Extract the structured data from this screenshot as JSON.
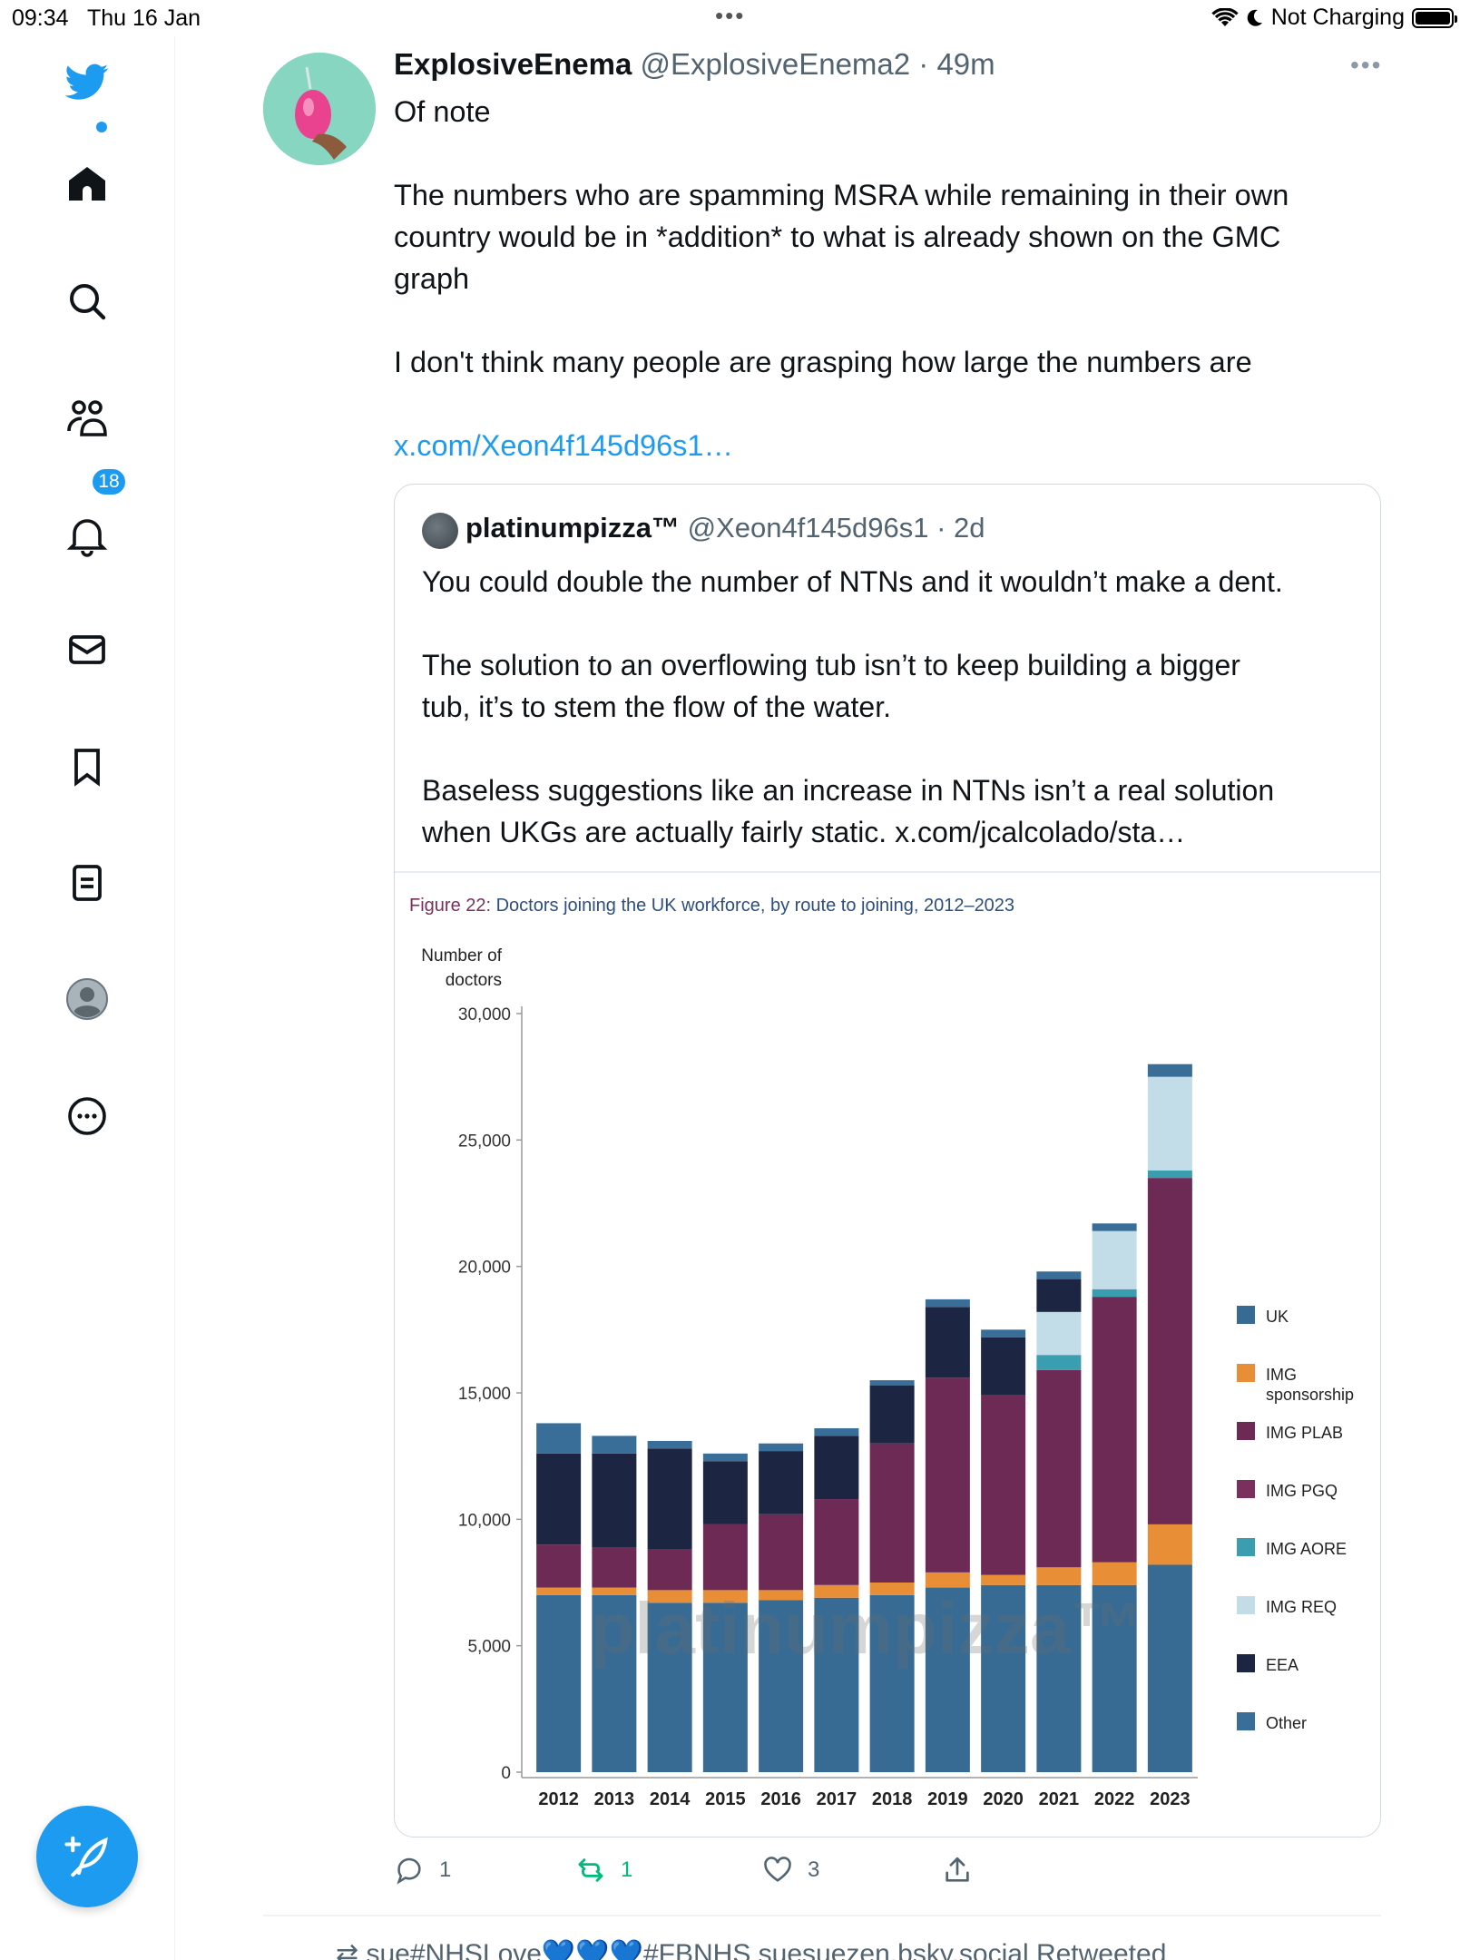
{
  "status_bar": {
    "time": "09:34",
    "date": "Thu 16 Jan",
    "battery_text": "Not Charging"
  },
  "sidebar": {
    "notifications_badge": "18",
    "accent_color": "#1d9bf0",
    "icons": [
      "twitter-logo-icon",
      "home-icon",
      "search-icon",
      "communities-icon",
      "notifications-icon",
      "messages-icon",
      "bookmarks-icon",
      "lists-icon",
      "profile-icon",
      "more-icon",
      "compose-icon"
    ]
  },
  "tweet": {
    "name": "ExplosiveEnema",
    "handle": "@ExplosiveEnema2",
    "time": "· 49m",
    "lines": [
      "Of note",
      "",
      "The numbers who are spamming MSRA while remaining in their own",
      "country would be in *addition* to what is already shown on the GMC",
      "graph",
      "",
      "I don't think many people are grasping how large the numbers are",
      ""
    ],
    "link": "x.com/Xeon4f145d96s1…",
    "actions": {
      "replies": "1",
      "retweets": "1",
      "likes": "3"
    }
  },
  "quote": {
    "name": "platinumpizza™",
    "handle": "@Xeon4f145d96s1",
    "time": "· 2d",
    "lines": [
      "You could double the number of NTNs and it wouldn’t make a dent.",
      "",
      "The solution to an overflowing tub isn’t to keep building a bigger",
      "tub, it’s to stem the flow of the water.",
      "",
      "Baseless suggestions like an increase in NTNs isn’t a real solution",
      "when UKGs are actually fairly static. x.com/jcalcolado/sta…"
    ]
  },
  "next_tweet_preview": "sue#NHSLove💙💙💙#FBNHS suesuezen.bsky.social Retweeted",
  "chart_data": {
    "type": "bar",
    "stacked": true,
    "title_prefix": "Figure 22:",
    "title": "Doctors joining the UK workforce, by route to joining, 2012–2023",
    "ylabel": "Number of doctors",
    "ylim": [
      0,
      30000
    ],
    "yticks": [
      "0",
      "5,000",
      "10,000",
      "15,000",
      "20,000",
      "25,000",
      "30,000"
    ],
    "watermark": "platinumpizza™",
    "categories": [
      "2012",
      "2013",
      "2014",
      "2015",
      "2016",
      "2017",
      "2018",
      "2019",
      "2020",
      "2021",
      "2022",
      "2023"
    ],
    "series": [
      {
        "name": "UK",
        "color": "#376b94",
        "values": [
          7000,
          7000,
          6700,
          6700,
          6800,
          6900,
          7000,
          7300,
          7400,
          7400,
          7400,
          8200
        ]
      },
      {
        "name": "IMG sponsorship",
        "color": "#e88e36",
        "values": [
          300,
          300,
          500,
          500,
          400,
          500,
          500,
          600,
          400,
          700,
          900,
          1600
        ]
      },
      {
        "name": "IMG PLAB",
        "color": "#6c2a55",
        "values": [
          1700,
          1600,
          1600,
          2600,
          3000,
          3400,
          5500,
          7700,
          7100,
          7800,
          10500,
          13700
        ]
      },
      {
        "name": "IMG PGQ",
        "color": "#7a2f5c",
        "values": [
          0,
          0,
          0,
          0,
          0,
          0,
          0,
          0,
          0,
          0,
          0,
          0
        ]
      },
      {
        "name": "IMG AORE",
        "color": "#3a9db0",
        "values": [
          0,
          0,
          0,
          0,
          0,
          0,
          0,
          0,
          0,
          600,
          300,
          300
        ]
      },
      {
        "name": "IMG REQ",
        "color": "#c2dde8",
        "values": [
          0,
          0,
          0,
          0,
          0,
          0,
          0,
          0,
          0,
          1700,
          2300,
          3700
        ]
      },
      {
        "name": "EEA",
        "color": "#1c2541",
        "values": [
          3600,
          3700,
          4000,
          2500,
          2500,
          2500,
          2300,
          2800,
          2300,
          1300,
          0,
          0
        ]
      },
      {
        "name": "Other",
        "color": "#396e98",
        "values": [
          1200,
          700,
          300,
          300,
          300,
          300,
          200,
          300,
          300,
          300,
          300,
          500
        ]
      }
    ]
  }
}
